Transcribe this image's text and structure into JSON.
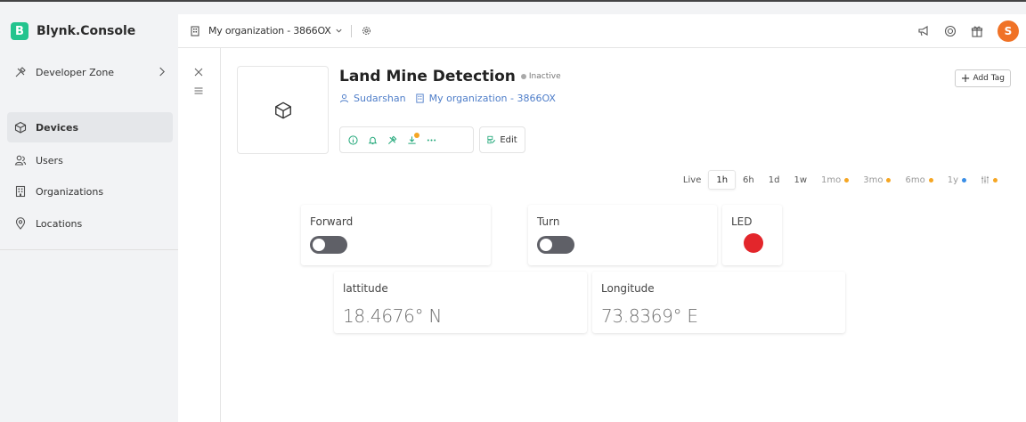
{
  "brand": {
    "name": "Blynk.Console",
    "logo_letter": "B"
  },
  "header": {
    "org_name": "My organization - 3866OX",
    "avatar_letter": "S",
    "avatar_color": "#f07226",
    "icons": [
      "megaphone-icon",
      "help-icon",
      "gift-icon"
    ]
  },
  "sidebar": {
    "items": [
      {
        "label": "Developer Zone",
        "icon": "tools-icon"
      },
      {
        "label": "Devices",
        "icon": "cube-icon",
        "active": true
      },
      {
        "label": "Users",
        "icon": "users-icon"
      },
      {
        "label": "Organizations",
        "icon": "building-icon"
      },
      {
        "label": "Locations",
        "icon": "location-icon"
      }
    ]
  },
  "device": {
    "name": "Land Mine Detection",
    "status": "Inactive",
    "owner": "Sudarshan",
    "organization": "My organization - 3866OX",
    "edit_label": "Edit",
    "add_tag_label": "Add Tag"
  },
  "time_tabs": [
    {
      "label": "Live"
    },
    {
      "label": "1h",
      "active": true
    },
    {
      "label": "6h"
    },
    {
      "label": "1d"
    },
    {
      "label": "1w"
    },
    {
      "label": "1mo",
      "dot": "orange"
    },
    {
      "label": "3mo",
      "dot": "orange"
    },
    {
      "label": "6mo",
      "dot": "orange"
    },
    {
      "label": "1y",
      "dot": "blue"
    },
    {
      "label": "",
      "icon": "sliders-icon",
      "dot": "orange"
    }
  ],
  "widgets": {
    "forward": {
      "label": "Forward",
      "state": "off"
    },
    "turn": {
      "label": "Turn",
      "state": "off"
    },
    "led": {
      "label": "LED",
      "color": "#e3262b"
    },
    "latitude": {
      "label": "lattitude",
      "value": "18.4676° N"
    },
    "longitude": {
      "label": "Longitude",
      "value": "73.8369° E"
    }
  },
  "colors": {
    "brand": "#23c48e",
    "link": "#4f7ec9",
    "led": "#e3262b",
    "switch_off": "#5f6067"
  }
}
